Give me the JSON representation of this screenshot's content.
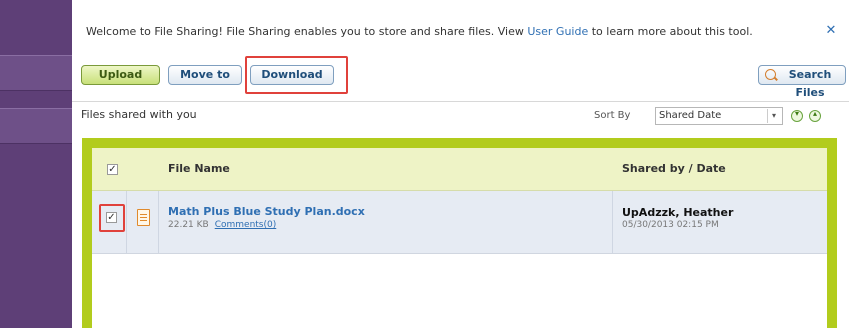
{
  "welcome": {
    "text_before": "Welcome to File Sharing! File Sharing enables you to store and share files. View ",
    "link": "User Guide",
    "text_after": " to learn more about this tool.",
    "close_symbol": "✕"
  },
  "toolbar": {
    "upload_label": "Upload",
    "move_label": "Move to",
    "download_label": "Download",
    "search_label": "Search Files"
  },
  "section": {
    "title": "Files shared with you",
    "sort_label": "Sort By",
    "sort_value": "Shared Date",
    "sort_arrow": "▾",
    "down_symbol": "▾",
    "up_symbol": "▴"
  },
  "table": {
    "header": {
      "checkbox": "✓",
      "name": "File Name",
      "shared": "Shared by / Date"
    },
    "rows": [
      {
        "checkbox": "✓",
        "name": "Math Plus Blue Study Plan.docx",
        "size": "22.21 KB",
        "comments": "Comments(0)",
        "shared_by": "UpAdzzk, Heather",
        "date": "05/30/2013 02:15 PM"
      }
    ]
  },
  "colors": {
    "rail": "#5e3f77",
    "accent_green": "#b2cc1d",
    "highlight_red": "#e0413b",
    "link_blue": "#2f6fb3"
  }
}
